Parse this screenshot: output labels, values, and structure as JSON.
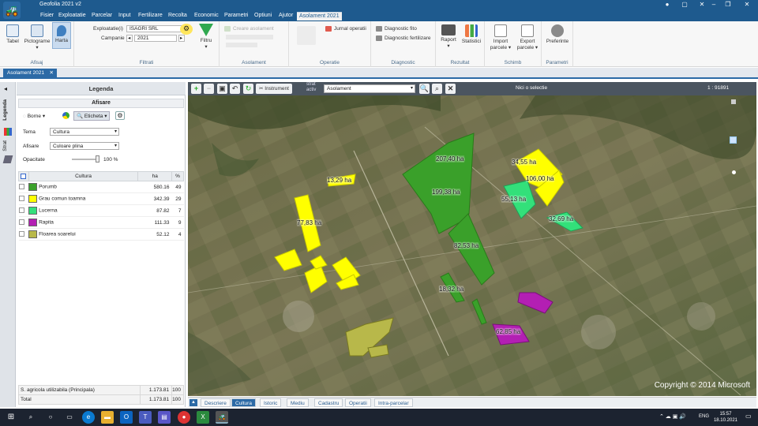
{
  "app": {
    "title": "Geofolia 2021 v2"
  },
  "menu": [
    "Fisier",
    "Exploatatie",
    "Parcelar",
    "Input",
    "Fertilizare",
    "Recolta",
    "Economic",
    "Parametri",
    "Optiuni",
    "Ajutor",
    "Asolament 2021"
  ],
  "ribbon": {
    "afisaj": {
      "label": "Afisaj",
      "buttons": [
        "Tabel",
        "Pictograme",
        "Harta"
      ]
    },
    "filtrati": {
      "label": "Filtrati",
      "exploatatie_label": "Exploatatie(i)",
      "exploatatie_value": "ISAGRI SRL",
      "campanie_label": "Campanie",
      "campanie_value": "2021",
      "filtru": "Filtru"
    },
    "asolament": {
      "label": "Asolament",
      "creare": "Creare asolament"
    },
    "operatie": {
      "label": "Operatie",
      "jurnal": "Jurnal operatii"
    },
    "diagnostic": {
      "label": "Diagnostic",
      "fito": "Diagnostic fito",
      "fert": "Diagnostic fertilizare"
    },
    "rezultat": {
      "label": "Rezultat",
      "raport": "Raport",
      "statistici": "Statistici"
    },
    "schimb": {
      "label": "Schimb",
      "import": "Import parcele",
      "export": "Export parcele"
    },
    "parametri": {
      "label": "Parametri",
      "preferinte": "Preferinte"
    }
  },
  "doc_tab": "Asolament 2021",
  "side_tabs": [
    "Legenda",
    "Strat"
  ],
  "legend": {
    "title": "Legenda",
    "afisare": "Afisare",
    "borne": "Borne",
    "eticheta": "Eticheta",
    "tema_label": "Tema",
    "tema_value": "Cultura",
    "afisare_label": "Afisare",
    "afisare_value": "Culoare plina",
    "opacitate_label": "Opacitate",
    "opacitate_value": "100 %",
    "opacity": 1.0,
    "columns": [
      "Cultura",
      "ha",
      "%"
    ],
    "rows": [
      {
        "name": "Porumb",
        "ha": "580.16",
        "pct": "49",
        "color": "#3aa02a"
      },
      {
        "name": "Grau comun toamna",
        "ha": "342.39",
        "pct": "29",
        "color": "#ffff00"
      },
      {
        "name": "Lucerna",
        "ha": "87.82",
        "pct": "7",
        "color": "#33e07a"
      },
      {
        "name": "Rapita",
        "ha": "111.33",
        "pct": "9",
        "color": "#b31fb3"
      },
      {
        "name": "Floarea soarelui",
        "ha": "52.12",
        "pct": "4",
        "color": "#b8b84a"
      }
    ],
    "totals": [
      {
        "name": "S. agricola utilizabila (Principala)",
        "ha": "1.173.81",
        "pct": "100"
      },
      {
        "name": "Total",
        "ha": "1.173.81",
        "pct": "100"
      }
    ]
  },
  "map": {
    "instrument": "Instrument",
    "strat_label": "strat activ",
    "strat_value": "Asolament",
    "selection": "Nici o selectie",
    "scale": "1 : 91891",
    "copyright": "Copyright © 2014 Microsoft",
    "labels": [
      "207,40 ha",
      "199,38 ha",
      "82,53 ha",
      "18,32 ha",
      "34,55 ha",
      "106,00 ha",
      "55,13 ha",
      "32,69 ha",
      "13,29 ha",
      "77,83 ha",
      "62,85 ha"
    ]
  },
  "bottom_tabs": [
    "Descriere",
    "Cultura",
    "Istoric",
    "Mediu",
    "Cadastru",
    "Operatii",
    "Intra-parcelar"
  ],
  "taskbar": {
    "lang": "ENG",
    "time": "15:57",
    "date": "18.10.2021"
  }
}
